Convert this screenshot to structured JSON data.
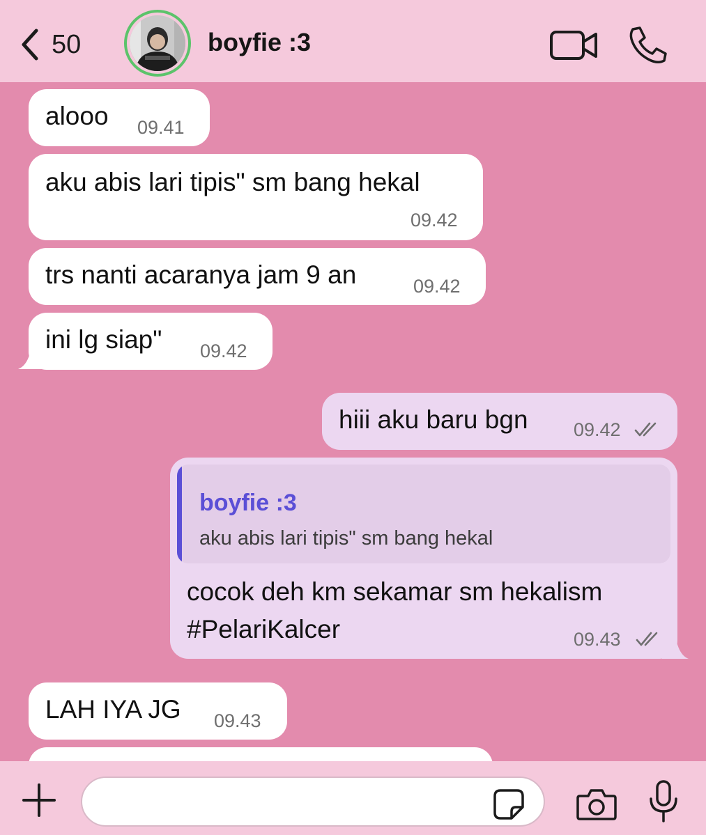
{
  "header": {
    "back_count": "50",
    "contact_name": "boyfie :3"
  },
  "messages": [
    {
      "dir": "in",
      "text": "alooo",
      "time": "09.41"
    },
    {
      "dir": "in",
      "text": "aku abis lari tipis\" sm bang hekal",
      "time": "09.42"
    },
    {
      "dir": "in",
      "text": "trs nanti acaranya jam 9 an",
      "time": "09.42"
    },
    {
      "dir": "in",
      "text": "ini lg siap\"",
      "time": "09.42"
    },
    {
      "dir": "out",
      "text": "hiii aku baru bgn",
      "time": "09.42",
      "status": "read"
    },
    {
      "dir": "out",
      "text_line1": "cocok deh km sekamar sm hekalism",
      "text_line2": "#PelariKalcer",
      "time": "09.43",
      "status": "read",
      "reply_to": {
        "name": "boyfie :3",
        "text": "aku abis lari tipis\" sm bang hekal"
      }
    },
    {
      "dir": "in",
      "text": "LAH IYA JG",
      "time": "09.43"
    }
  ],
  "composer": {
    "placeholder": "",
    "value": ""
  },
  "colors": {
    "chat_background": "#e38bad",
    "header_background": "#f5c9dc",
    "incoming_bubble": "#ffffff",
    "outgoing_bubble": "#ecd7f1",
    "quote_accent": "#5b4fd6",
    "avatar_ring": "#5cc36b"
  },
  "icons": [
    "chevron-left-icon",
    "video-camera-icon",
    "phone-icon",
    "plus-icon",
    "sticker-icon",
    "camera-icon",
    "microphone-icon",
    "double-check-icon"
  ]
}
